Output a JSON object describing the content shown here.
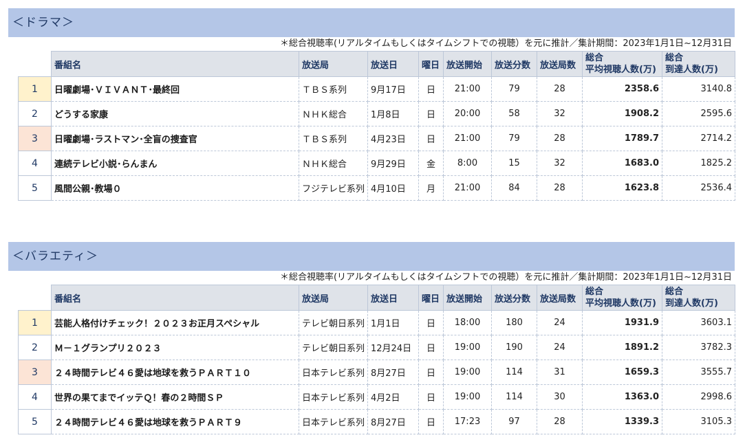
{
  "drama": {
    "title": "＜ドラマ＞",
    "note": "＊総合視聴率(リアルタイムもしくはタイムシフトでの視聴）を元に推計／集計期間：2023年1月1日~12月31日",
    "headers": {
      "name": "番組名",
      "station": "放送局",
      "date": "放送日",
      "day": "曜日",
      "start": "放送開始",
      "minutes": "放送分数",
      "stations": "放送局数",
      "avg_line1": "総合",
      "avg_line2": "平均視聴人数(万)",
      "reach_line1": "総合",
      "reach_line2": "到達人数(万)"
    },
    "rows": [
      {
        "rank": "1",
        "name": "日曜劇場･ＶＩＶＡＮＴ･最終回",
        "station": "ＴＢＳ系列",
        "date": "9月17日",
        "day": "日",
        "start": "21:00",
        "minutes": "79",
        "stations": "28",
        "avg": "2358.6",
        "reach": "3140.8"
      },
      {
        "rank": "2",
        "name": "どうする家康",
        "station": "ＮＨＫ総合",
        "date": "1月8日",
        "day": "日",
        "start": "20:00",
        "minutes": "58",
        "stations": "32",
        "avg": "1908.2",
        "reach": "2595.6"
      },
      {
        "rank": "3",
        "name": "日曜劇場･ラストマン･全盲の捜査官",
        "station": "ＴＢＳ系列",
        "date": "4月23日",
        "day": "日",
        "start": "21:00",
        "minutes": "79",
        "stations": "28",
        "avg": "1789.7",
        "reach": "2714.2"
      },
      {
        "rank": "4",
        "name": "連続テレビ小説･らんまん",
        "station": "ＮＨＫ総合",
        "date": "9月29日",
        "day": "金",
        "start": "8:00",
        "minutes": "15",
        "stations": "32",
        "avg": "1683.0",
        "reach": "1825.2"
      },
      {
        "rank": "5",
        "name": "風間公親･教場０",
        "station": "フジテレビ系列",
        "date": "4月10日",
        "day": "月",
        "start": "21:00",
        "minutes": "84",
        "stations": "28",
        "avg": "1623.8",
        "reach": "2536.4"
      }
    ]
  },
  "variety": {
    "title": "＜バラエティ＞",
    "note": "＊総合視聴率(リアルタイムもしくはタイムシフトでの視聴）を元に推計／集計期間：2023年1月1日~12月31日",
    "headers": {
      "name": "番組名",
      "station": "放送局",
      "date": "放送日",
      "day": "曜日",
      "start": "放送開始",
      "minutes": "放送分数",
      "stations": "放送局数",
      "avg_line1": "総合",
      "avg_line2": "平均視聴人数(万)",
      "reach_line1": "総合",
      "reach_line2": "到達人数(万)"
    },
    "rows": [
      {
        "rank": "1",
        "name": "芸能人格付けチェック！２０２３お正月スペシャル",
        "station": "テレビ朝日系列",
        "date": "1月1日",
        "day": "日",
        "start": "18:00",
        "minutes": "180",
        "stations": "24",
        "avg": "1931.9",
        "reach": "3603.1"
      },
      {
        "rank": "2",
        "name": "Ｍ－１グランプリ２０２３",
        "station": "テレビ朝日系列",
        "date": "12月24日",
        "day": "日",
        "start": "19:00",
        "minutes": "190",
        "stations": "24",
        "avg": "1891.2",
        "reach": "3782.3"
      },
      {
        "rank": "3",
        "name": "２４時間テレビ４６愛は地球を救うＰＡＲＴ１０",
        "station": "日本テレビ系列",
        "date": "8月27日",
        "day": "日",
        "start": "19:00",
        "minutes": "114",
        "stations": "31",
        "avg": "1659.3",
        "reach": "3555.7"
      },
      {
        "rank": "4",
        "name": "世界の果てまでイッテＱ！春の２時間ＳＰ",
        "station": "日本テレビ系列",
        "date": "4月2日",
        "day": "日",
        "start": "19:00",
        "minutes": "114",
        "stations": "30",
        "avg": "1363.0",
        "reach": "2998.6"
      },
      {
        "rank": "5",
        "name": "２４時間テレビ４６愛は地球を救うＰＡＲＴ９",
        "station": "日本テレビ系列",
        "date": "8月27日",
        "day": "日",
        "start": "17:23",
        "minutes": "97",
        "stations": "28",
        "avg": "1339.3",
        "reach": "3105.3"
      }
    ]
  }
}
